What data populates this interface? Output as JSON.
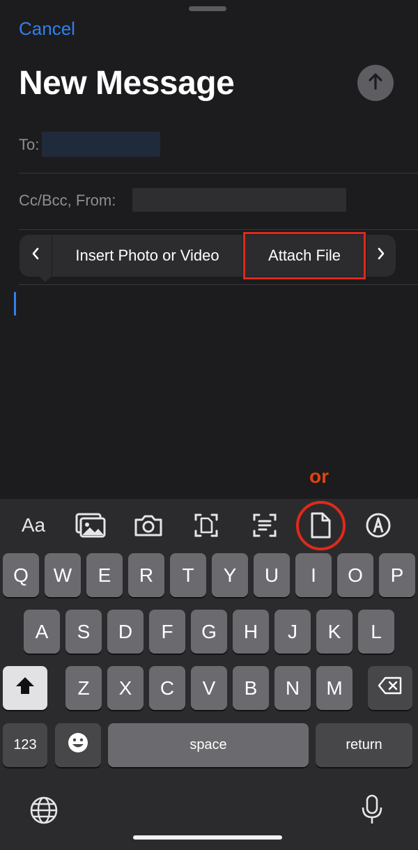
{
  "compose": {
    "cancel_label": "Cancel",
    "title": "New Message",
    "to_label": "To:",
    "cc_label": "Cc/Bcc, From:"
  },
  "callout": {
    "insert_photo_label": "Insert Photo or Video",
    "attach_file_label": "Attach File"
  },
  "annotation": {
    "or_label": "or",
    "color": "#e0291b"
  },
  "toolbar": {
    "format_label": "Aa",
    "icons": [
      "photo-library-icon",
      "camera-icon",
      "scan-document-icon",
      "scan-text-icon",
      "document-icon",
      "markup-icon"
    ]
  },
  "keyboard": {
    "row1": [
      "Q",
      "W",
      "E",
      "R",
      "T",
      "Y",
      "U",
      "I",
      "O",
      "P"
    ],
    "row2": [
      "A",
      "S",
      "D",
      "F",
      "G",
      "H",
      "J",
      "K",
      "L"
    ],
    "row3": [
      "Z",
      "X",
      "C",
      "V",
      "B",
      "N",
      "M"
    ],
    "numbers_label": "123",
    "space_label": "space",
    "return_label": "return"
  },
  "colors": {
    "accent": "#2f80f0",
    "background": "#1c1c1e",
    "keyboard_bg": "#2b2b2d"
  }
}
